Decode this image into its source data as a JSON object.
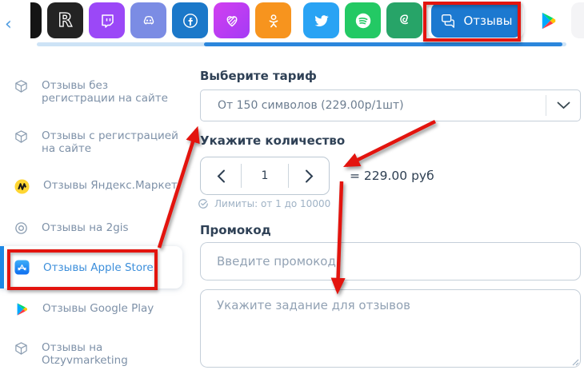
{
  "colors": {
    "annotation_red": "#e3140e",
    "accent_blue": "#1e88e5",
    "scroll_track": "#cde3f6",
    "scroll_thumb": "#2b86dc",
    "sidebar_text": "#7e91a8",
    "sidebar_active_text": "#3d8fdb",
    "label_text": "#2f4156"
  },
  "topbar": {
    "back_icon": "‹",
    "apps": [
      {
        "icon": "app-partial",
        "bg": "#141414"
      },
      {
        "icon": "app-r",
        "bg": "#232323"
      },
      {
        "icon": "twitch",
        "bg": "#9b48f7"
      },
      {
        "icon": "discord",
        "bg": "#7b8ce4"
      },
      {
        "icon": "facebook",
        "bg": "#1b78c9"
      },
      {
        "icon": "heart-stripes",
        "bg": "linear-gradient(135deg,#d23ff0,#a43bf5)"
      },
      {
        "icon": "odnoklassniki",
        "bg": "#f7941e"
      },
      {
        "icon": "twitter",
        "bg": "#29a3f4"
      },
      {
        "icon": "spotify",
        "bg": "#23c964"
      },
      {
        "icon": "green-curl",
        "bg": "#27a468"
      },
      {
        "icon": "google-play",
        "bg": "#ffffff"
      },
      {
        "icon": "app-partial-right",
        "bg": "#f4f4f6"
      }
    ],
    "reviews_button": {
      "label": "Отзывы",
      "bg": "#1c79d0",
      "icon": "chat-bubbles"
    }
  },
  "sidebar": {
    "items": [
      {
        "label": "Отзывы без\nрегистрации на сайте",
        "icon": "package"
      },
      {
        "label": "Отзывы с регистрацией\nна сайте",
        "icon": "package"
      },
      {
        "label": "Отзывы Яндекс.Маркет",
        "icon": "yandex-market"
      },
      {
        "label": "Отзывы на 2gis",
        "icon": "2gis"
      },
      {
        "label": "Отзывы Apple Store",
        "icon": "app-store",
        "active": true
      },
      {
        "label": "Отзывы Google Play",
        "icon": "google-play"
      },
      {
        "label": "Отзывы на\nOtzyvmarketing",
        "icon": "package"
      }
    ]
  },
  "form": {
    "tariff": {
      "label": "Выберите тариф",
      "selected": "От 150 символов (229.00р/1шт)"
    },
    "quantity": {
      "label": "Укажите количество",
      "value": "1",
      "total": "= 229.00 руб",
      "limits": "Лимиты: от 1 до 10000"
    },
    "promo": {
      "label": "Промокод",
      "placeholder": "Введите промокод"
    },
    "task": {
      "placeholder": "Укажите задание для отзывов"
    }
  }
}
